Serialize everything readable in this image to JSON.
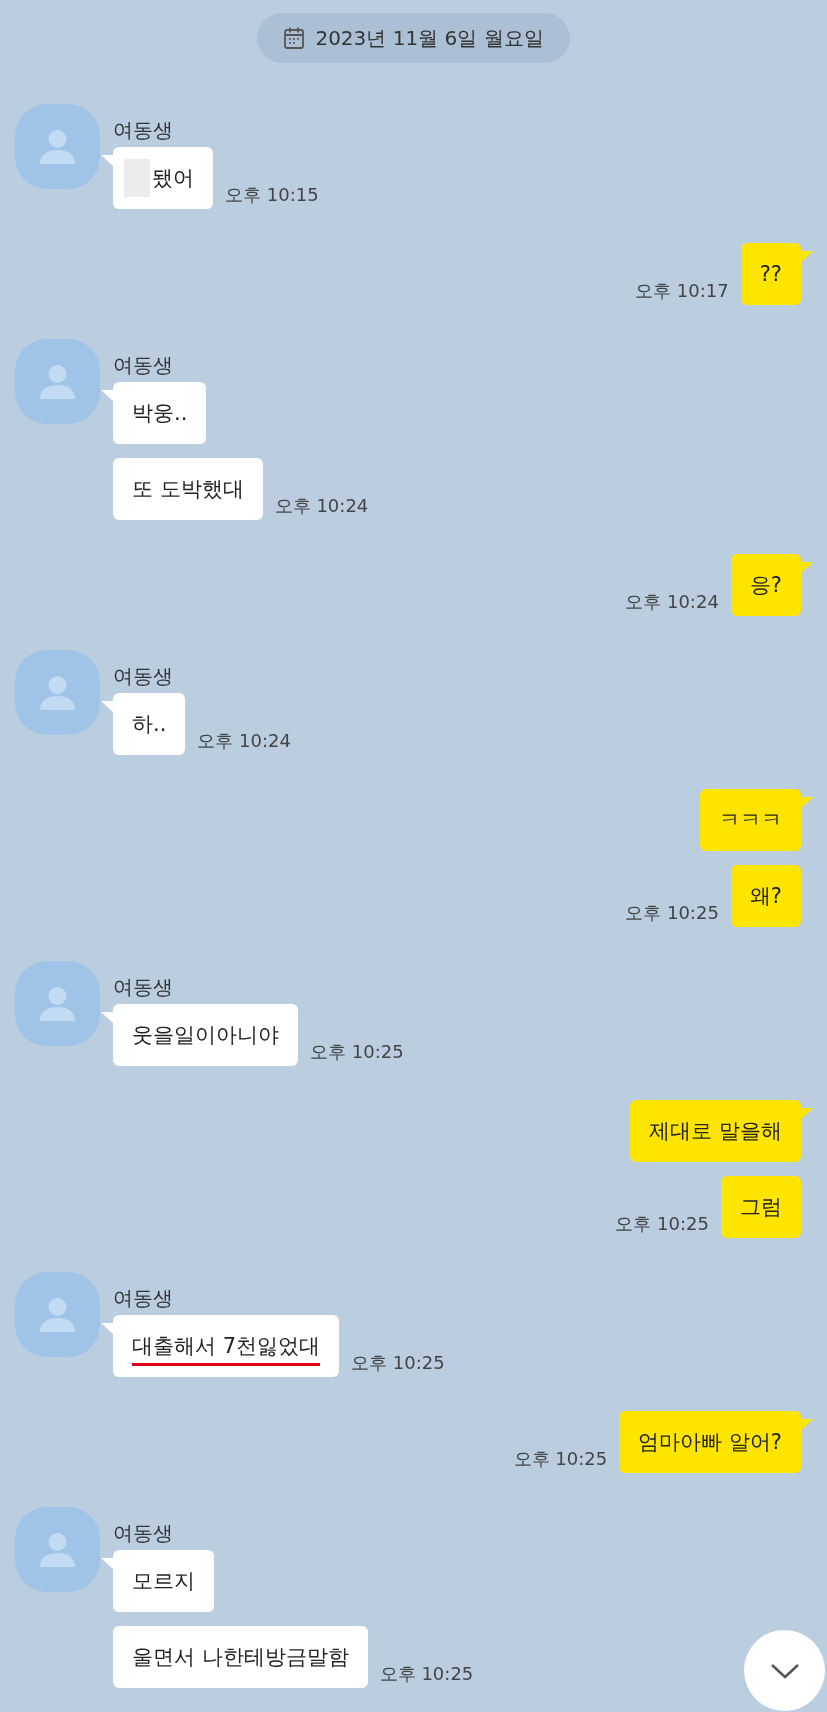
{
  "date_divider": {
    "text": "2023년 11월 6일 월요일"
  },
  "groups": [
    {
      "kind": "incoming",
      "sender": "여동생",
      "time": "오후 10:15",
      "messages": [
        {
          "text": "됐어",
          "redacted": true,
          "underlined": false
        }
      ]
    },
    {
      "kind": "outgoing",
      "time": "오후 10:17",
      "messages": [
        {
          "text": "??",
          "redacted": false,
          "underlined": false
        }
      ]
    },
    {
      "kind": "incoming",
      "sender": "여동생",
      "time": "오후 10:24",
      "messages": [
        {
          "text": "박웅..",
          "redacted": false,
          "underlined": false
        },
        {
          "text": "또 도박했대",
          "redacted": false,
          "underlined": false
        }
      ]
    },
    {
      "kind": "outgoing",
      "time": "오후 10:24",
      "messages": [
        {
          "text": "응?",
          "redacted": false,
          "underlined": false
        }
      ]
    },
    {
      "kind": "incoming",
      "sender": "여동생",
      "time": "오후 10:24",
      "messages": [
        {
          "text": "하..",
          "redacted": false,
          "underlined": false
        }
      ]
    },
    {
      "kind": "outgoing",
      "time": "오후 10:25",
      "messages": [
        {
          "text": "ㅋㅋㅋ",
          "redacted": false,
          "underlined": false
        },
        {
          "text": "왜?",
          "redacted": false,
          "underlined": false
        }
      ]
    },
    {
      "kind": "incoming",
      "sender": "여동생",
      "time": "오후 10:25",
      "messages": [
        {
          "text": "웃을일이아니야",
          "redacted": false,
          "underlined": false
        }
      ]
    },
    {
      "kind": "outgoing",
      "time": "오후 10:25",
      "messages": [
        {
          "text": "제대로 말을해",
          "redacted": false,
          "underlined": false
        },
        {
          "text": "그럼",
          "redacted": false,
          "underlined": false
        }
      ]
    },
    {
      "kind": "incoming",
      "sender": "여동생",
      "time": "오후 10:25",
      "messages": [
        {
          "text": "대출해서 7천잃었대",
          "redacted": false,
          "underlined": true
        }
      ]
    },
    {
      "kind": "outgoing",
      "time": "오후 10:25",
      "messages": [
        {
          "text": "엄마아빠 알어?",
          "redacted": false,
          "underlined": false
        }
      ]
    },
    {
      "kind": "incoming",
      "sender": "여동생",
      "time": "오후 10:25",
      "messages": [
        {
          "text": "모르지",
          "redacted": false,
          "underlined": false
        },
        {
          "text": "울면서 나한테방금말함",
          "redacted": false,
          "underlined": false
        }
      ]
    }
  ]
}
